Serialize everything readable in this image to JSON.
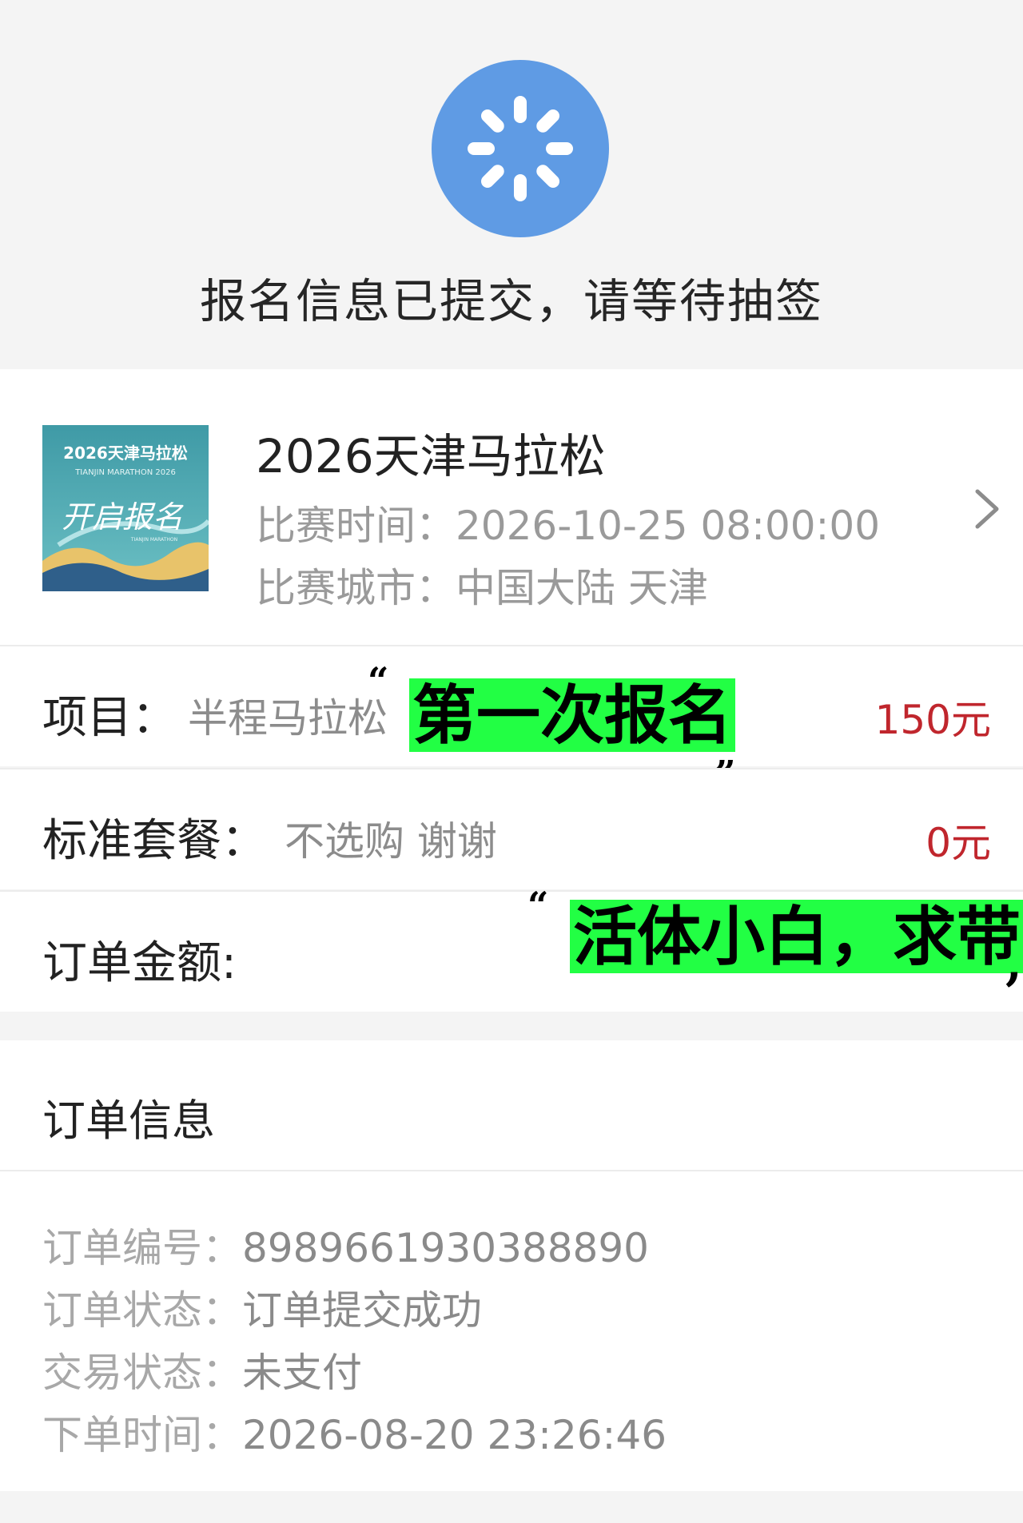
{
  "status": {
    "title": "报名信息已提交，请等待抽签",
    "icon": "loading-spinner-icon",
    "icon_color": "#5f9be4"
  },
  "event": {
    "thumbnail": {
      "year_title": "2026天津马拉松",
      "subtitle_en": "TIANJIN MARATHON 2026",
      "slogan": "开启报名",
      "small_text": "TIANJIN MARATHON"
    },
    "title": "2026天津马拉松",
    "time_label": "比赛时间：",
    "time_value": "2026-10-25 08:00:00",
    "city_label": "比赛城市：",
    "city_value": "中国大陆 天津"
  },
  "rows": {
    "project": {
      "label": "项目：",
      "value": "半程马拉松",
      "price": "150元"
    },
    "package": {
      "label": "标准套餐：",
      "value": "不选购 谢谢",
      "price": "0元"
    },
    "amount": {
      "label": "订单金额:"
    }
  },
  "annotations": {
    "first": {
      "open_quote": "“",
      "text": "第一次报名",
      "close_quote": "„"
    },
    "second": {
      "open_quote": "“",
      "text": "活体小白，求带",
      "close_quote": ","
    }
  },
  "order": {
    "header": "订单信息",
    "number_label": "订单编号：",
    "number_value": "8989661930388890",
    "status_label": "订单状态：",
    "status_value": "订单提交成功",
    "trade_label": "交易状态：",
    "trade_value": "未支付",
    "time_label": "下单时间：",
    "time_value": "2026-08-20 23:26:46"
  },
  "colors": {
    "accent_blue": "#5f9be4",
    "price_red": "#c0262d",
    "highlight_green": "#22ff44"
  }
}
